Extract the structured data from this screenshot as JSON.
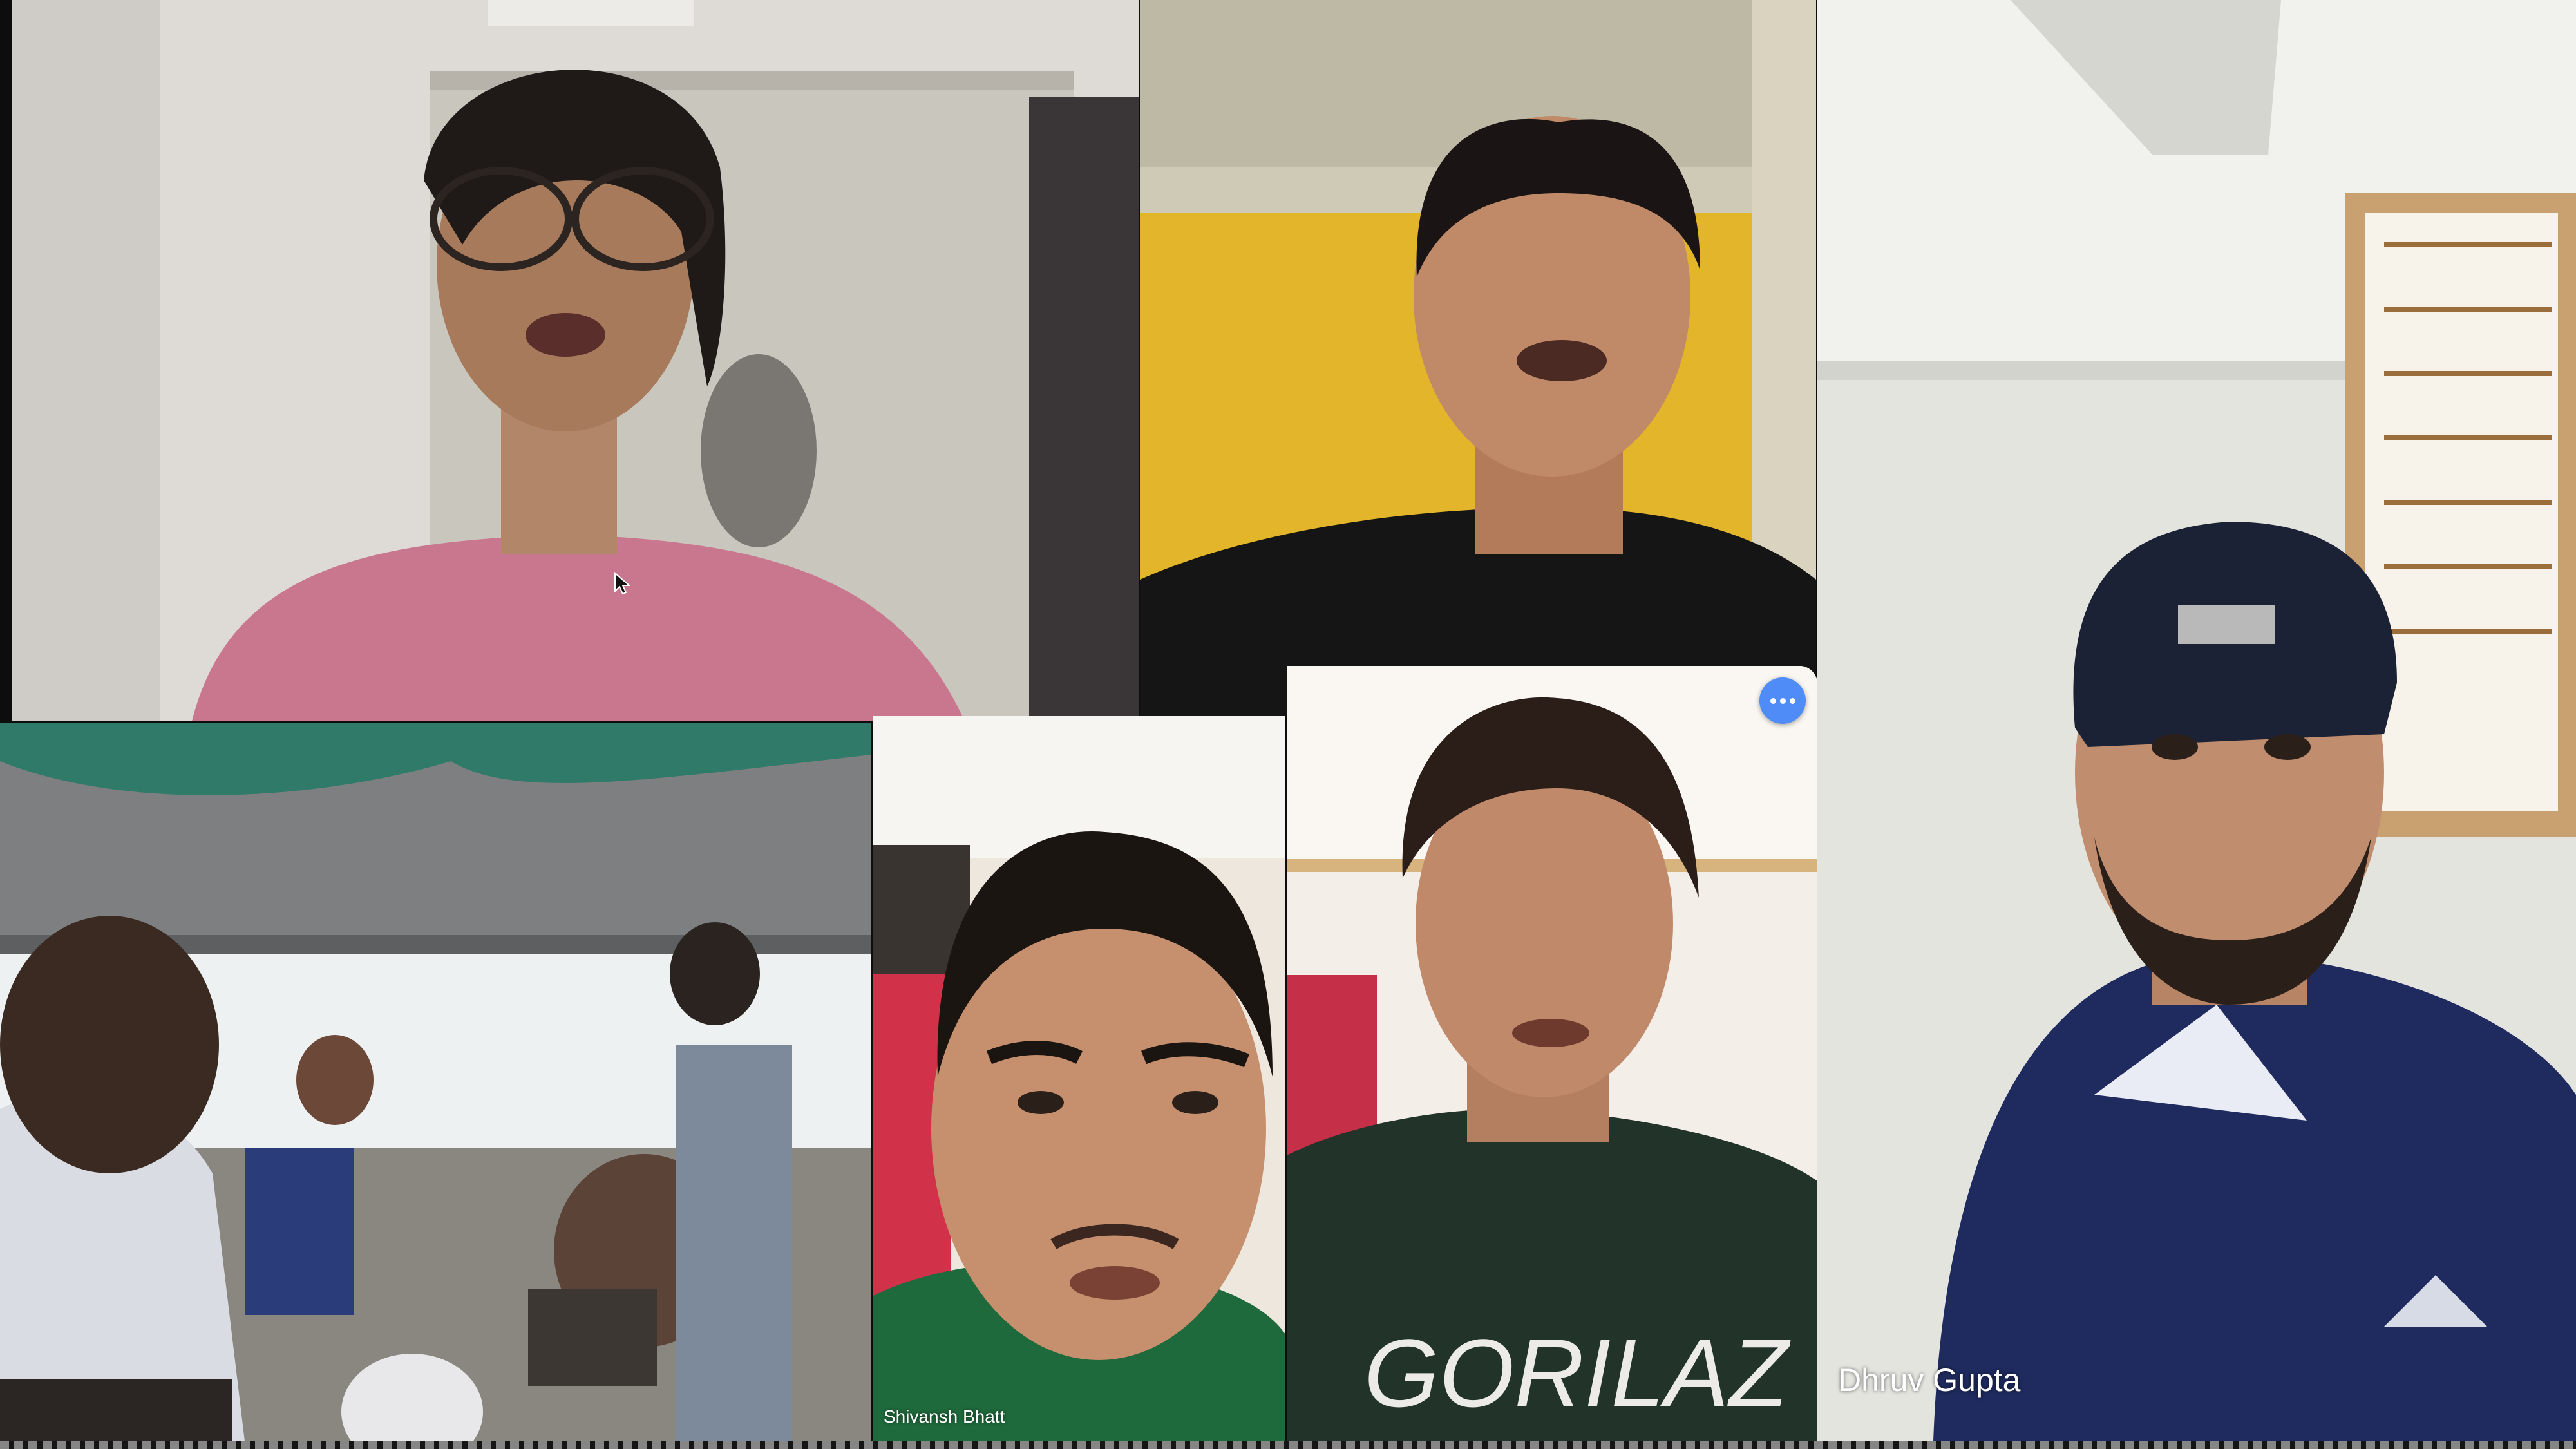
{
  "call": {
    "participants": [
      {
        "id": "p1",
        "name": ""
      },
      {
        "id": "p2",
        "name": ""
      },
      {
        "id": "p3",
        "name": "Dhruv Gupta"
      },
      {
        "id": "p4",
        "name": ""
      },
      {
        "id": "p5",
        "name": "Shivansh Bhatt"
      },
      {
        "id": "p6",
        "name": ""
      }
    ],
    "tile_controls": {
      "more_icon": "more-horizontal-icon"
    },
    "colors": {
      "accent": "#4f8cf7",
      "wall_yellow": "#e2b52a",
      "shirt_navy": "#1f2a5e"
    }
  }
}
